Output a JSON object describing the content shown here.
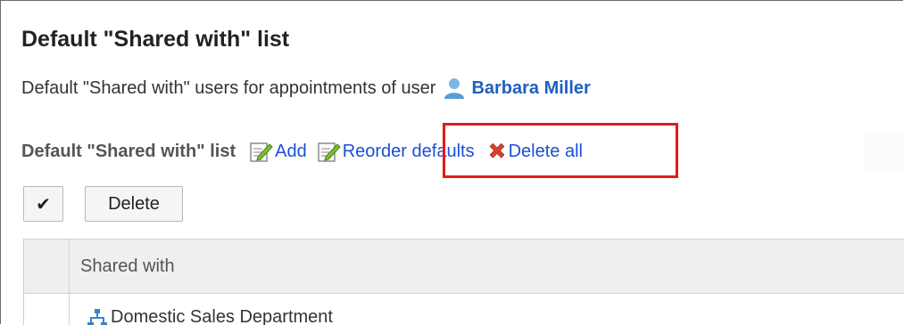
{
  "page": {
    "title": "Default \"Shared with\" list",
    "description": "Default \"Shared with\" users for appointments of user",
    "user_name": "Barbara Miller"
  },
  "toolbar": {
    "label": "Default \"Shared with\" list",
    "add_label": "Add",
    "reorder_label": "Reorder defaults",
    "delete_all_label": "Delete all"
  },
  "buttons": {
    "check_all": "✔",
    "delete": "Delete"
  },
  "table": {
    "header": "Shared with",
    "rows": [
      {
        "name": "Domestic Sales Department",
        "icon": "org-icon"
      }
    ]
  },
  "colors": {
    "link": "#1a4fd6",
    "highlight": "#e31a1a",
    "header_bg": "#efefef"
  }
}
